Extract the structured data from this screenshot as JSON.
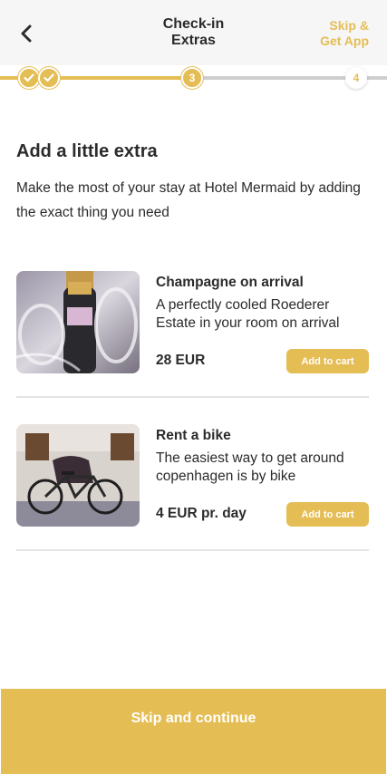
{
  "header": {
    "title": "Check-in\nExtras",
    "skip_label": "Skip &\nGet App"
  },
  "progress": {
    "steps": [
      {
        "state": "done",
        "label": ""
      },
      {
        "state": "done",
        "label": ""
      },
      {
        "state": "current",
        "label": "3"
      },
      {
        "state": "upcoming",
        "label": "4"
      }
    ]
  },
  "section": {
    "title": "Add a little extra",
    "description": "Make the most of your stay at Hotel Mermaid by adding the exact thing you need"
  },
  "extras": [
    {
      "name": "Champagne on arrival",
      "description": "A perfectly cooled Roederer Estate in your room on arrival",
      "price": "28 EUR",
      "button": "Add to cart"
    },
    {
      "name": "Rent a bike",
      "description": "The easiest way to get around copenhagen is by bike",
      "price": "4 EUR pr. day",
      "button": "Add to cart"
    }
  ],
  "footer": {
    "continue_label": "Skip and continue"
  },
  "colors": {
    "accent": "#e5bd55",
    "header_bg": "#f6f6f6",
    "text": "#2b2b2b",
    "track": "#cfcfcf"
  }
}
